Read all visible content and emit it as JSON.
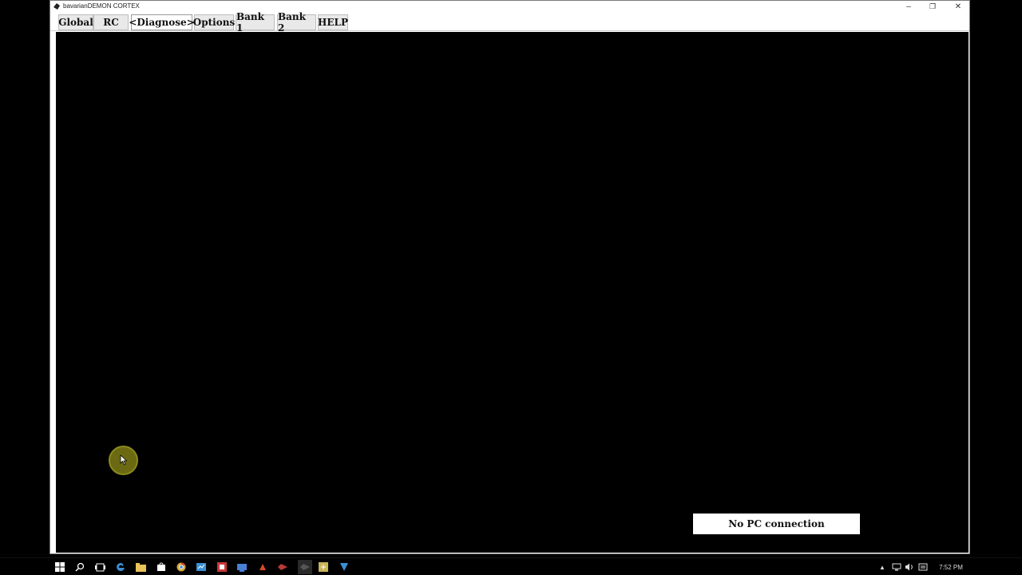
{
  "window": {
    "title": "bavarianDEMON CORTEX",
    "controls": {
      "minimize": "–",
      "restore": "❐",
      "close": "✕"
    }
  },
  "menu": {
    "tabs": [
      {
        "label": "Global"
      },
      {
        "label": "RC"
      },
      {
        "label": "<Diagnose>"
      },
      {
        "label": "Options"
      },
      {
        "label": "Bank 1"
      },
      {
        "label": "Bank 2"
      },
      {
        "label": "HELP"
      }
    ],
    "active_tab": "<Diagnose>"
  },
  "status": {
    "text": "No PC connection"
  },
  "taskbar": {
    "icons": [
      "windows-start-icon",
      "search-icon",
      "task-view-icon",
      "edge-icon",
      "file-explorer-icon",
      "store-icon",
      "chrome-icon",
      "app-icon-1",
      "app-icon-2",
      "app-icon-3",
      "app-icon-4",
      "app-icon-5",
      "app-icon-6",
      "app-icon-7",
      "app-icon-8"
    ],
    "clock": "7:52 PM"
  },
  "colors": {
    "accent_taskbar_icons": "#3b8fd6",
    "cursor_halo": "#6b6a12"
  }
}
